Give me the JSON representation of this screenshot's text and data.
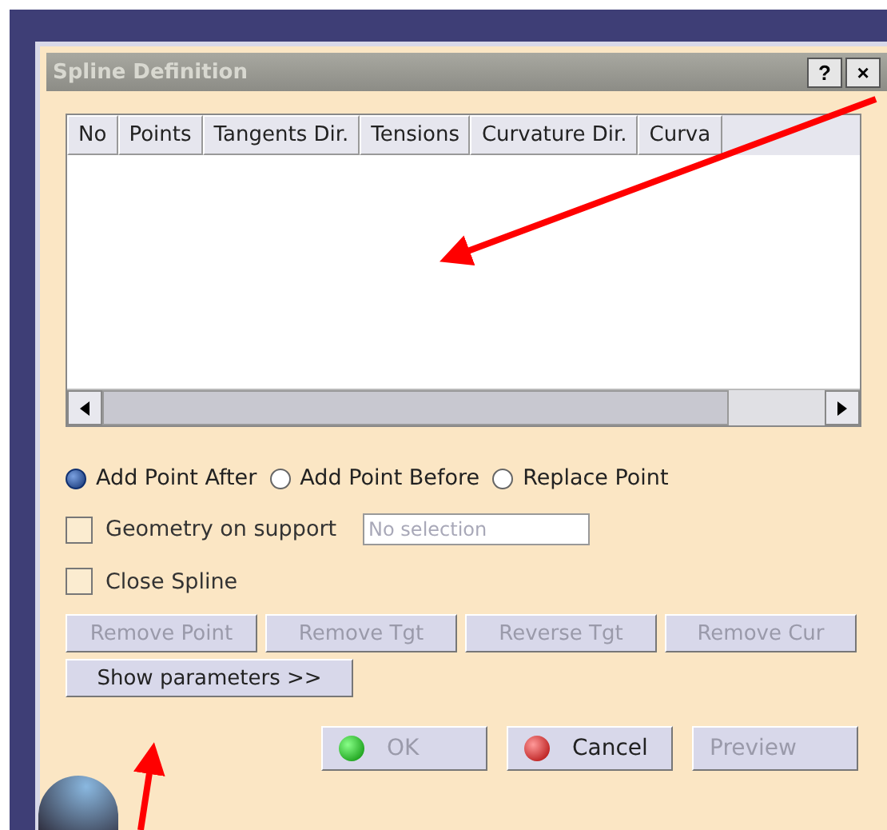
{
  "window": {
    "title": "Spline Definition",
    "help_button": "?",
    "close_button": "×"
  },
  "table": {
    "columns": [
      "No",
      "Points",
      "Tangents Dir.",
      "Tensions",
      "Curvature Dir.",
      "Curva"
    ]
  },
  "insert_mode": [
    {
      "label": "Add Point After",
      "selected": true
    },
    {
      "label": "Add Point Before",
      "selected": false
    },
    {
      "label": "Replace Point",
      "selected": false
    }
  ],
  "geometry_on_support": {
    "label": "Geometry on support",
    "checked": false,
    "placeholder": "No selection"
  },
  "close_spline": {
    "label": "Close Spline",
    "checked": false
  },
  "edit_buttons": [
    {
      "label": "Remove Point",
      "disabled": true
    },
    {
      "label": "Remove Tgt",
      "disabled": true
    },
    {
      "label": "Reverse Tgt",
      "disabled": true
    },
    {
      "label": "Remove Cur",
      "disabled": true
    }
  ],
  "show_parameters": {
    "label": "Show parameters >>",
    "disabled": false
  },
  "dialog_buttons": [
    {
      "label": "OK",
      "kind": "ok",
      "disabled": true
    },
    {
      "label": "Cancel",
      "kind": "cancel",
      "disabled": false
    },
    {
      "label": "Preview",
      "kind": "plain",
      "disabled": true
    }
  ]
}
